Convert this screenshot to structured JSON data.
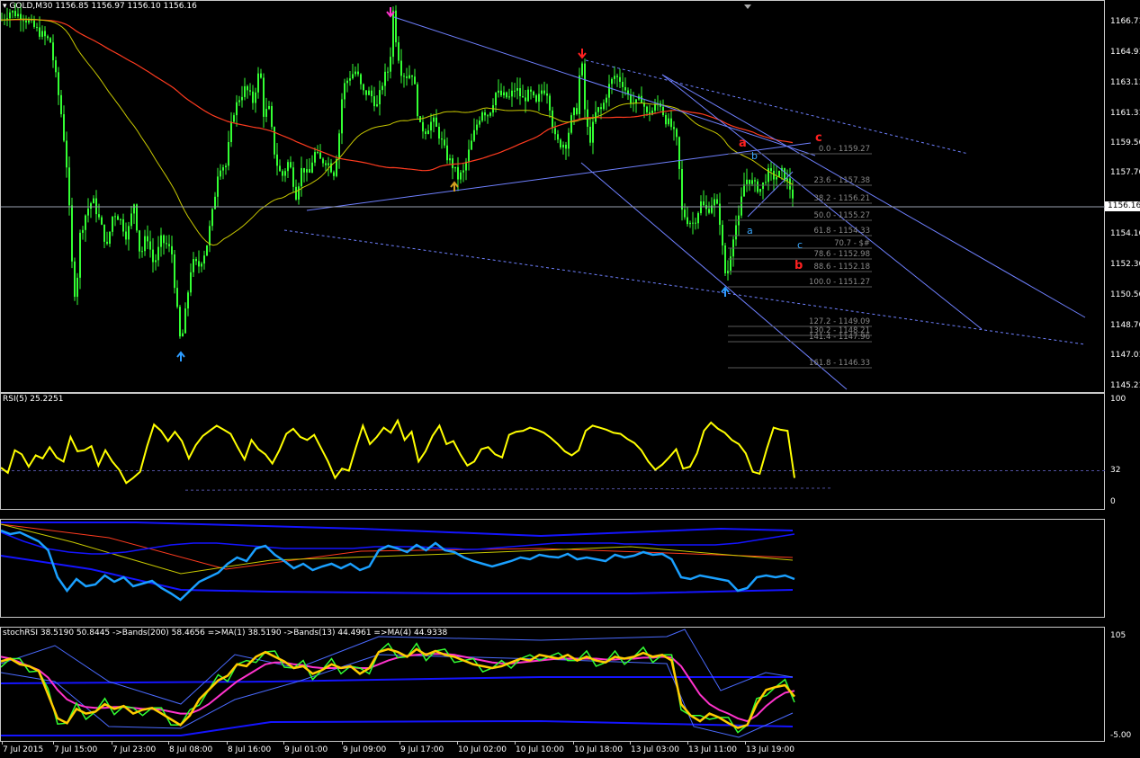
{
  "main": {
    "title": "GOLD,M30",
    "ohlc": "1156.85 1156.97 1156.10 1156.16",
    "current_price": "1156.16",
    "price_labels": [
      "1166.71",
      "1164.91",
      "1163.11",
      "1161.31",
      "1159.56",
      "1157.76",
      "1156.16",
      "1154.16",
      "1152.36",
      "1150.56",
      "1148.76",
      "1147.01",
      "1145.21"
    ],
    "fib_levels": [
      {
        "label": "0.0 - 1159.27"
      },
      {
        "label": "23.6 - 1157.38"
      },
      {
        "label": "38.2 - 1156.21"
      },
      {
        "label": "50.0 - 1155.27"
      },
      {
        "label": "61.8 - 1154.33"
      },
      {
        "label": "70.7 - $#"
      },
      {
        "label": "78.6 - 1152.98"
      },
      {
        "label": "88.6 - 1152.18"
      },
      {
        "label": "100.0 - 1151.27"
      },
      {
        "label": "127.2 - 1149.09"
      },
      {
        "label": "130.2 - 1148.21"
      },
      {
        "label": "141.4 - 1147.96"
      },
      {
        "label": "161.8 - 1146.33"
      }
    ],
    "wave_labels": [
      {
        "text": "a",
        "color": "#ff2020"
      },
      {
        "text": "c",
        "color": "#ff2020"
      },
      {
        "text": "b",
        "color": "#ff2020"
      },
      {
        "text": "a",
        "color": "#3aa8ff"
      },
      {
        "text": "b",
        "color": "#3aa8ff"
      },
      {
        "text": "c",
        "color": "#3aa8ff"
      }
    ]
  },
  "rsi": {
    "title": "RSI(5) 25.2251",
    "levels": [
      "100",
      "32",
      "0"
    ]
  },
  "stoch": {
    "title": "stochRSI 38.5190 50.8445  ->Bands(200) 58.4656  =>MA(1) 38.5190  ->Bands(13) 44.4961  =>MA(4) 44.9338",
    "levels": [
      "105",
      "-5.00"
    ]
  },
  "time_labels": [
    "7 Jul 2015",
    "7 Jul 15:00",
    "7 Jul 23:00",
    "8 Jul 08:00",
    "8 Jul 16:00",
    "9 Jul 01:00",
    "9 Jul 09:00",
    "9 Jul 17:00",
    "10 Jul 02:00",
    "10 Jul 10:00",
    "10 Jul 18:00",
    "13 Jul 03:00",
    "13 Jul 11:00",
    "13 Jul 19:00"
  ],
  "chart_data": [
    {
      "type": "candlestick",
      "title": "GOLD,M30",
      "ylim": [
        1145.21,
        1167.6
      ],
      "series": [
        {
          "name": "GOLD,M30",
          "close_points": [
            [
              0,
              1166.9
            ],
            [
              10,
              1167.4
            ],
            [
              25,
              1167.1
            ],
            [
              40,
              1166.3
            ],
            [
              55,
              1165.6
            ],
            [
              62,
              1163.2
            ],
            [
              68,
              1161.0
            ],
            [
              74,
              1157.8
            ],
            [
              79,
              1152.5
            ],
            [
              83,
              1150.3
            ],
            [
              88,
              1154.2
            ],
            [
              95,
              1155.6
            ],
            [
              102,
              1156.3
            ],
            [
              110,
              1155.0
            ],
            [
              118,
              1153.5
            ],
            [
              125,
              1155.6
            ],
            [
              132,
              1155.2
            ],
            [
              140,
              1154.1
            ],
            [
              148,
              1156.1
            ],
            [
              155,
              1152.9
            ],
            [
              162,
              1154.3
            ],
            [
              170,
              1152.4
            ],
            [
              178,
              1153.9
            ],
            [
              185,
              1153.6
            ],
            [
              190,
              1153.1
            ],
            [
              195,
              1150.2
            ],
            [
              200,
              1147.6
            ],
            [
              205,
              1149.6
            ],
            [
              212,
              1152.6
            ],
            [
              220,
              1152.4
            ],
            [
              228,
              1153.4
            ],
            [
              236,
              1155.8
            ],
            [
              242,
              1158.3
            ],
            [
              250,
              1158.3
            ],
            [
              258,
              1161.4
            ],
            [
              265,
              1162.3
            ],
            [
              272,
              1162.9
            ],
            [
              280,
              1162.1
            ],
            [
              288,
              1164.1
            ],
            [
              292,
              1161.4
            ],
            [
              298,
              1161.6
            ],
            [
              305,
              1158.7
            ],
            [
              312,
              1157.6
            ],
            [
              320,
              1158.6
            ],
            [
              328,
              1156.6
            ],
            [
              335,
              1158.3
            ],
            [
              342,
              1157.6
            ],
            [
              348,
              1159.1
            ],
            [
              355,
              1158.6
            ],
            [
              362,
              1158.6
            ],
            [
              370,
              1157.9
            ],
            [
              375,
              1159.6
            ],
            [
              380,
              1162.9
            ],
            [
              388,
              1163.6
            ],
            [
              395,
              1163.9
            ],
            [
              402,
              1162.6
            ],
            [
              410,
              1162.6
            ],
            [
              418,
              1161.8
            ],
            [
              425,
              1163.4
            ],
            [
              432,
              1164.1
            ],
            [
              436,
              1167.4
            ],
            [
              440,
              1165.3
            ],
            [
              445,
              1163.9
            ],
            [
              450,
              1163.6
            ],
            [
              458,
              1163.8
            ],
            [
              465,
              1160.6
            ],
            [
              472,
              1160.4
            ],
            [
              480,
              1161.0
            ],
            [
              488,
              1160.0
            ],
            [
              495,
              1158.9
            ],
            [
              502,
              1158.3
            ],
            [
              508,
              1157.6
            ],
            [
              514,
              1157.9
            ],
            [
              520,
              1159.1
            ],
            [
              528,
              1160.6
            ],
            [
              535,
              1161.6
            ],
            [
              542,
              1161.3
            ],
            [
              550,
              1162.6
            ],
            [
              558,
              1162.4
            ],
            [
              565,
              1162.3
            ],
            [
              572,
              1162.9
            ],
            [
              580,
              1162.2
            ],
            [
              588,
              1162.6
            ],
            [
              595,
              1161.9
            ],
            [
              602,
              1162.9
            ],
            [
              608,
              1162.6
            ],
            [
              615,
              1160.0
            ],
            [
              620,
              1159.6
            ],
            [
              628,
              1159.6
            ],
            [
              635,
              1161.3
            ],
            [
              640,
              1161.6
            ],
            [
              645,
              1164.9
            ],
            [
              650,
              1160.8
            ],
            [
              655,
              1159.9
            ],
            [
              662,
              1161.6
            ],
            [
              668,
              1161.6
            ],
            [
              675,
              1162.9
            ],
            [
              682,
              1163.6
            ],
            [
              690,
              1163.3
            ],
            [
              698,
              1162.3
            ],
            [
              705,
              1161.9
            ],
            [
              712,
              1162.3
            ],
            [
              718,
              1161.3
            ],
            [
              725,
              1161.6
            ],
            [
              732,
              1162.1
            ],
            [
              738,
              1161.1
            ],
            [
              745,
              1160.6
            ],
            [
              752,
              1159.6
            ],
            [
              757,
              1155.6
            ],
            [
              763,
              1155.1
            ],
            [
              770,
              1154.9
            ],
            [
              778,
              1156.1
            ],
            [
              785,
              1155.6
            ],
            [
              792,
              1156.3
            ],
            [
              798,
              1155.6
            ],
            [
              802,
              1153.4
            ],
            [
              806,
              1151.5
            ],
            [
              810,
              1152.8
            ],
            [
              815,
              1154.6
            ],
            [
              820,
              1155.1
            ],
            [
              825,
              1157.1
            ],
            [
              830,
              1157.6
            ],
            [
              838,
              1157.1
            ],
            [
              845,
              1156.9
            ],
            [
              852,
              1157.9
            ],
            [
              860,
              1157.6
            ],
            [
              868,
              1157.9
            ],
            [
              875,
              1157.3
            ],
            [
              882,
              1156.2
            ]
          ]
        }
      ],
      "indicators": [
        {
          "name": "MA red",
          "color": "#ff3b1f"
        },
        {
          "name": "MA yellow",
          "color": "#c8c800"
        }
      ],
      "grid": false,
      "current_price": 1156.16
    },
    {
      "type": "line",
      "title": "RSI(5) 25.2251",
      "ylim": [
        0,
        100
      ],
      "reference_levels": [
        32
      ],
      "series": [
        {
          "name": "RSI(5)",
          "values": [
            35,
            30,
            52,
            48,
            36,
            47,
            44,
            55,
            45,
            41,
            65,
            51,
            52,
            56,
            37,
            52,
            41,
            33,
            20,
            25,
            31,
            56,
            77,
            71,
            61,
            70,
            61,
            44,
            57,
            66,
            71,
            76,
            72,
            68,
            55,
            43,
            62,
            53,
            48,
            39,
            52,
            68,
            73,
            65,
            62,
            67,
            54,
            41,
            25,
            34,
            32,
            55,
            76,
            58,
            65,
            74,
            69,
            81,
            62,
            70,
            41,
            51,
            66,
            76,
            58,
            61,
            48,
            37,
            41,
            53,
            55,
            48,
            45,
            67,
            70,
            71,
            74,
            72,
            69,
            64,
            58,
            51,
            47,
            52,
            71,
            76,
            74,
            72,
            69,
            68,
            63,
            59,
            52,
            41,
            33,
            38,
            45,
            53,
            34,
            36,
            49,
            71,
            79,
            73,
            69,
            62,
            58,
            49,
            31,
            29,
            53,
            74,
            72,
            71,
            25
          ]
        }
      ],
      "grid": false
    },
    {
      "type": "line",
      "title": "",
      "ylim": [
        0,
        100
      ],
      "series": [
        {
          "name": "",
          "color": "#1aa0ff",
          "values": [
            92,
            88,
            90,
            85,
            80,
            70,
            40,
            25,
            38,
            30,
            32,
            42,
            35,
            40,
            30,
            33,
            36,
            28,
            22,
            15,
            25,
            35,
            40,
            45,
            55,
            62,
            58,
            72,
            75,
            65,
            58,
            50,
            55,
            48,
            52,
            55,
            50,
            55,
            48,
            52,
            70,
            75,
            72,
            68,
            76,
            70,
            78,
            70,
            68,
            62,
            58,
            55,
            52,
            55,
            58,
            62,
            60,
            65,
            63,
            62,
            66,
            60,
            62,
            60,
            58,
            65,
            62,
            64,
            68,
            65,
            66,
            60,
            40,
            38,
            42,
            40,
            38,
            36,
            25,
            28,
            40,
            42,
            40,
            42,
            38
          ]
        },
        {
          "name": "",
          "color": "#1414ff",
          "values": [
            90,
            85,
            80,
            76,
            72,
            70,
            68,
            67,
            66,
            66,
            67,
            68,
            70,
            72,
            74,
            76,
            77,
            78,
            78,
            78,
            77,
            76,
            75,
            74,
            73,
            72,
            72,
            72,
            72,
            72,
            72,
            72,
            73,
            74,
            74,
            74,
            74,
            74,
            73,
            72,
            72,
            71,
            71,
            72,
            73,
            74,
            75,
            76,
            77,
            78,
            78,
            78,
            78,
            78,
            78,
            77,
            77,
            77,
            76,
            76,
            76,
            76,
            76,
            76,
            77,
            78,
            80,
            82,
            84,
            86,
            88
          ]
        }
      ],
      "grid": false
    },
    {
      "type": "line",
      "title": "stochRSI 38.5190 50.8445  ->Bands(200) 58.4656  =>MA(1) 38.5190  ->Bands(13) 44.4961  =>MA(4) 44.9338",
      "ylim": [
        -5,
        105
      ],
      "series": [
        {
          "name": "stochRSI",
          "color": "#ffcc00",
          "values": [
            75,
            78,
            72,
            70,
            65,
            40,
            15,
            10,
            25,
            20,
            22,
            30,
            25,
            28,
            20,
            24,
            26,
            20,
            14,
            8,
            18,
            35,
            45,
            55,
            60,
            72,
            70,
            80,
            85,
            80,
            75,
            68,
            70,
            62,
            66,
            72,
            68,
            70,
            62,
            68,
            85,
            88,
            85,
            80,
            88,
            82,
            86,
            82,
            80,
            76,
            72,
            70,
            68,
            70,
            74,
            78,
            76,
            82,
            80,
            78,
            82,
            76,
            80,
            76,
            74,
            80,
            78,
            80,
            84,
            80,
            82,
            76,
            30,
            18,
            12,
            20,
            16,
            10,
            5,
            8,
            30,
            45,
            48,
            50,
            38
          ]
        },
        {
          "name": "MA",
          "color": "#ff33cc",
          "values": [
            80,
            78,
            74,
            70,
            66,
            58,
            45,
            35,
            30,
            27,
            26,
            26,
            27,
            27,
            26,
            25,
            25,
            24,
            22,
            20,
            20,
            24,
            30,
            38,
            46,
            54,
            60,
            66,
            72,
            74,
            74,
            72,
            71,
            69,
            68,
            68,
            68,
            69,
            68,
            68,
            72,
            76,
            79,
            81,
            82,
            83,
            83,
            83,
            82,
            80,
            78,
            76,
            74,
            73,
            73,
            74,
            75,
            76,
            77,
            78,
            78,
            78,
            78,
            78,
            77,
            77,
            78,
            78,
            79,
            79,
            80,
            79,
            70,
            55,
            40,
            30,
            24,
            20,
            15,
            12,
            18,
            28,
            36,
            42,
            44
          ]
        }
      ],
      "grid": false
    }
  ]
}
